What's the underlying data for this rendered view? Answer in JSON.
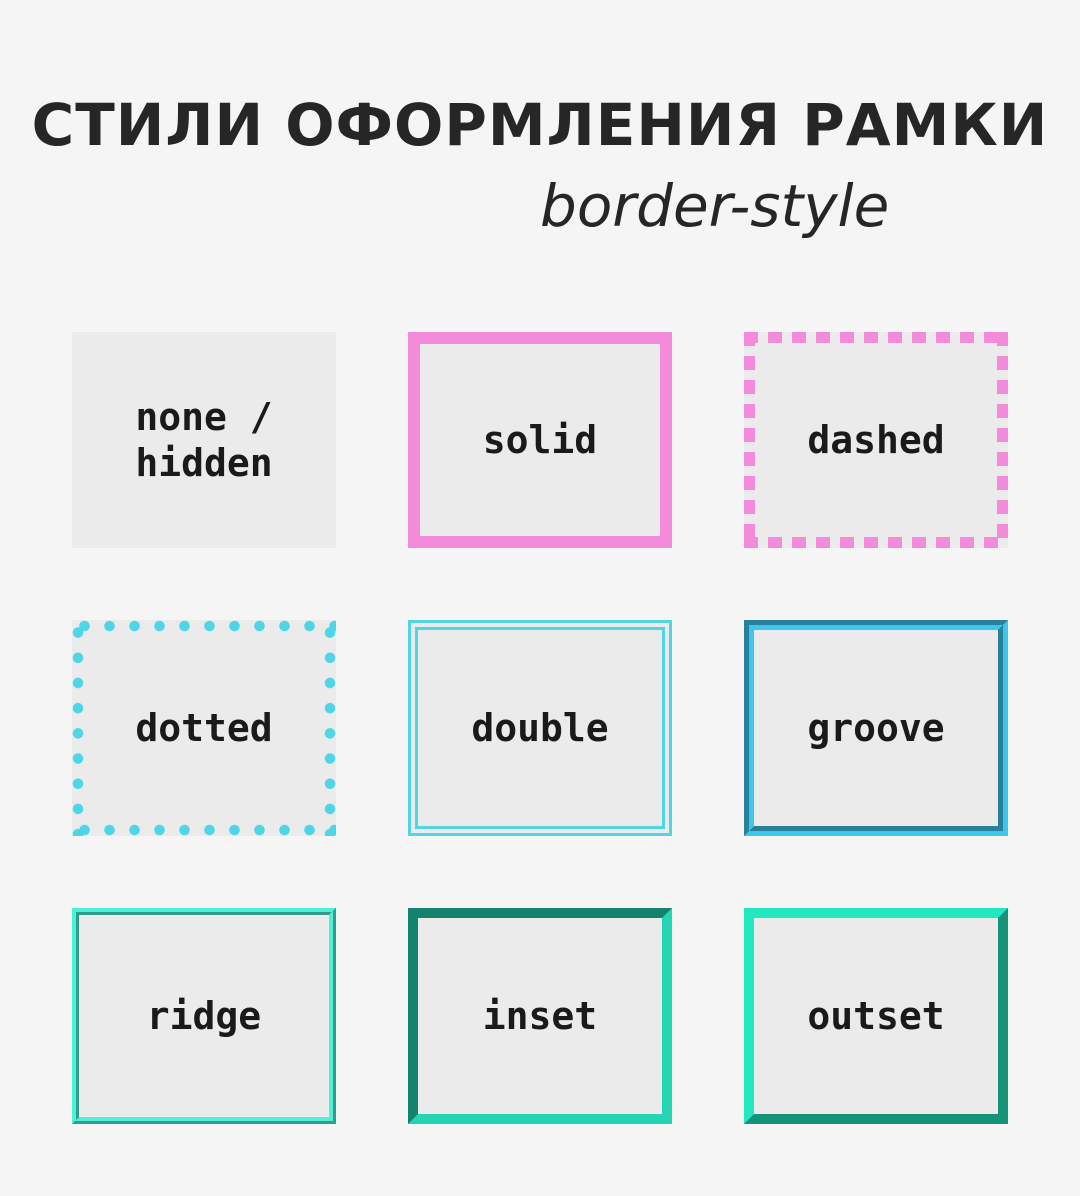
{
  "header": {
    "title": "СТИЛИ ОФОРМЛЕНИЯ РАМКИ",
    "subtitle": "border-style"
  },
  "colors": {
    "pink": "#f48ada",
    "cyan": "#4fd6e6",
    "blue": "#3ec6ee",
    "teal": "#22d6b4",
    "card_bg": "#ecebec",
    "page_bg": "#f5f5f6",
    "text": "#262626"
  },
  "cards": [
    {
      "label": "none /\nhidden",
      "style": "none"
    },
    {
      "label": "solid",
      "style": "solid"
    },
    {
      "label": "dashed",
      "style": "dashed"
    },
    {
      "label": "dotted",
      "style": "dotted"
    },
    {
      "label": "double",
      "style": "double"
    },
    {
      "label": "groove",
      "style": "groove"
    },
    {
      "label": "ridge",
      "style": "ridge"
    },
    {
      "label": "inset",
      "style": "inset"
    },
    {
      "label": "outset",
      "style": "outset"
    }
  ]
}
